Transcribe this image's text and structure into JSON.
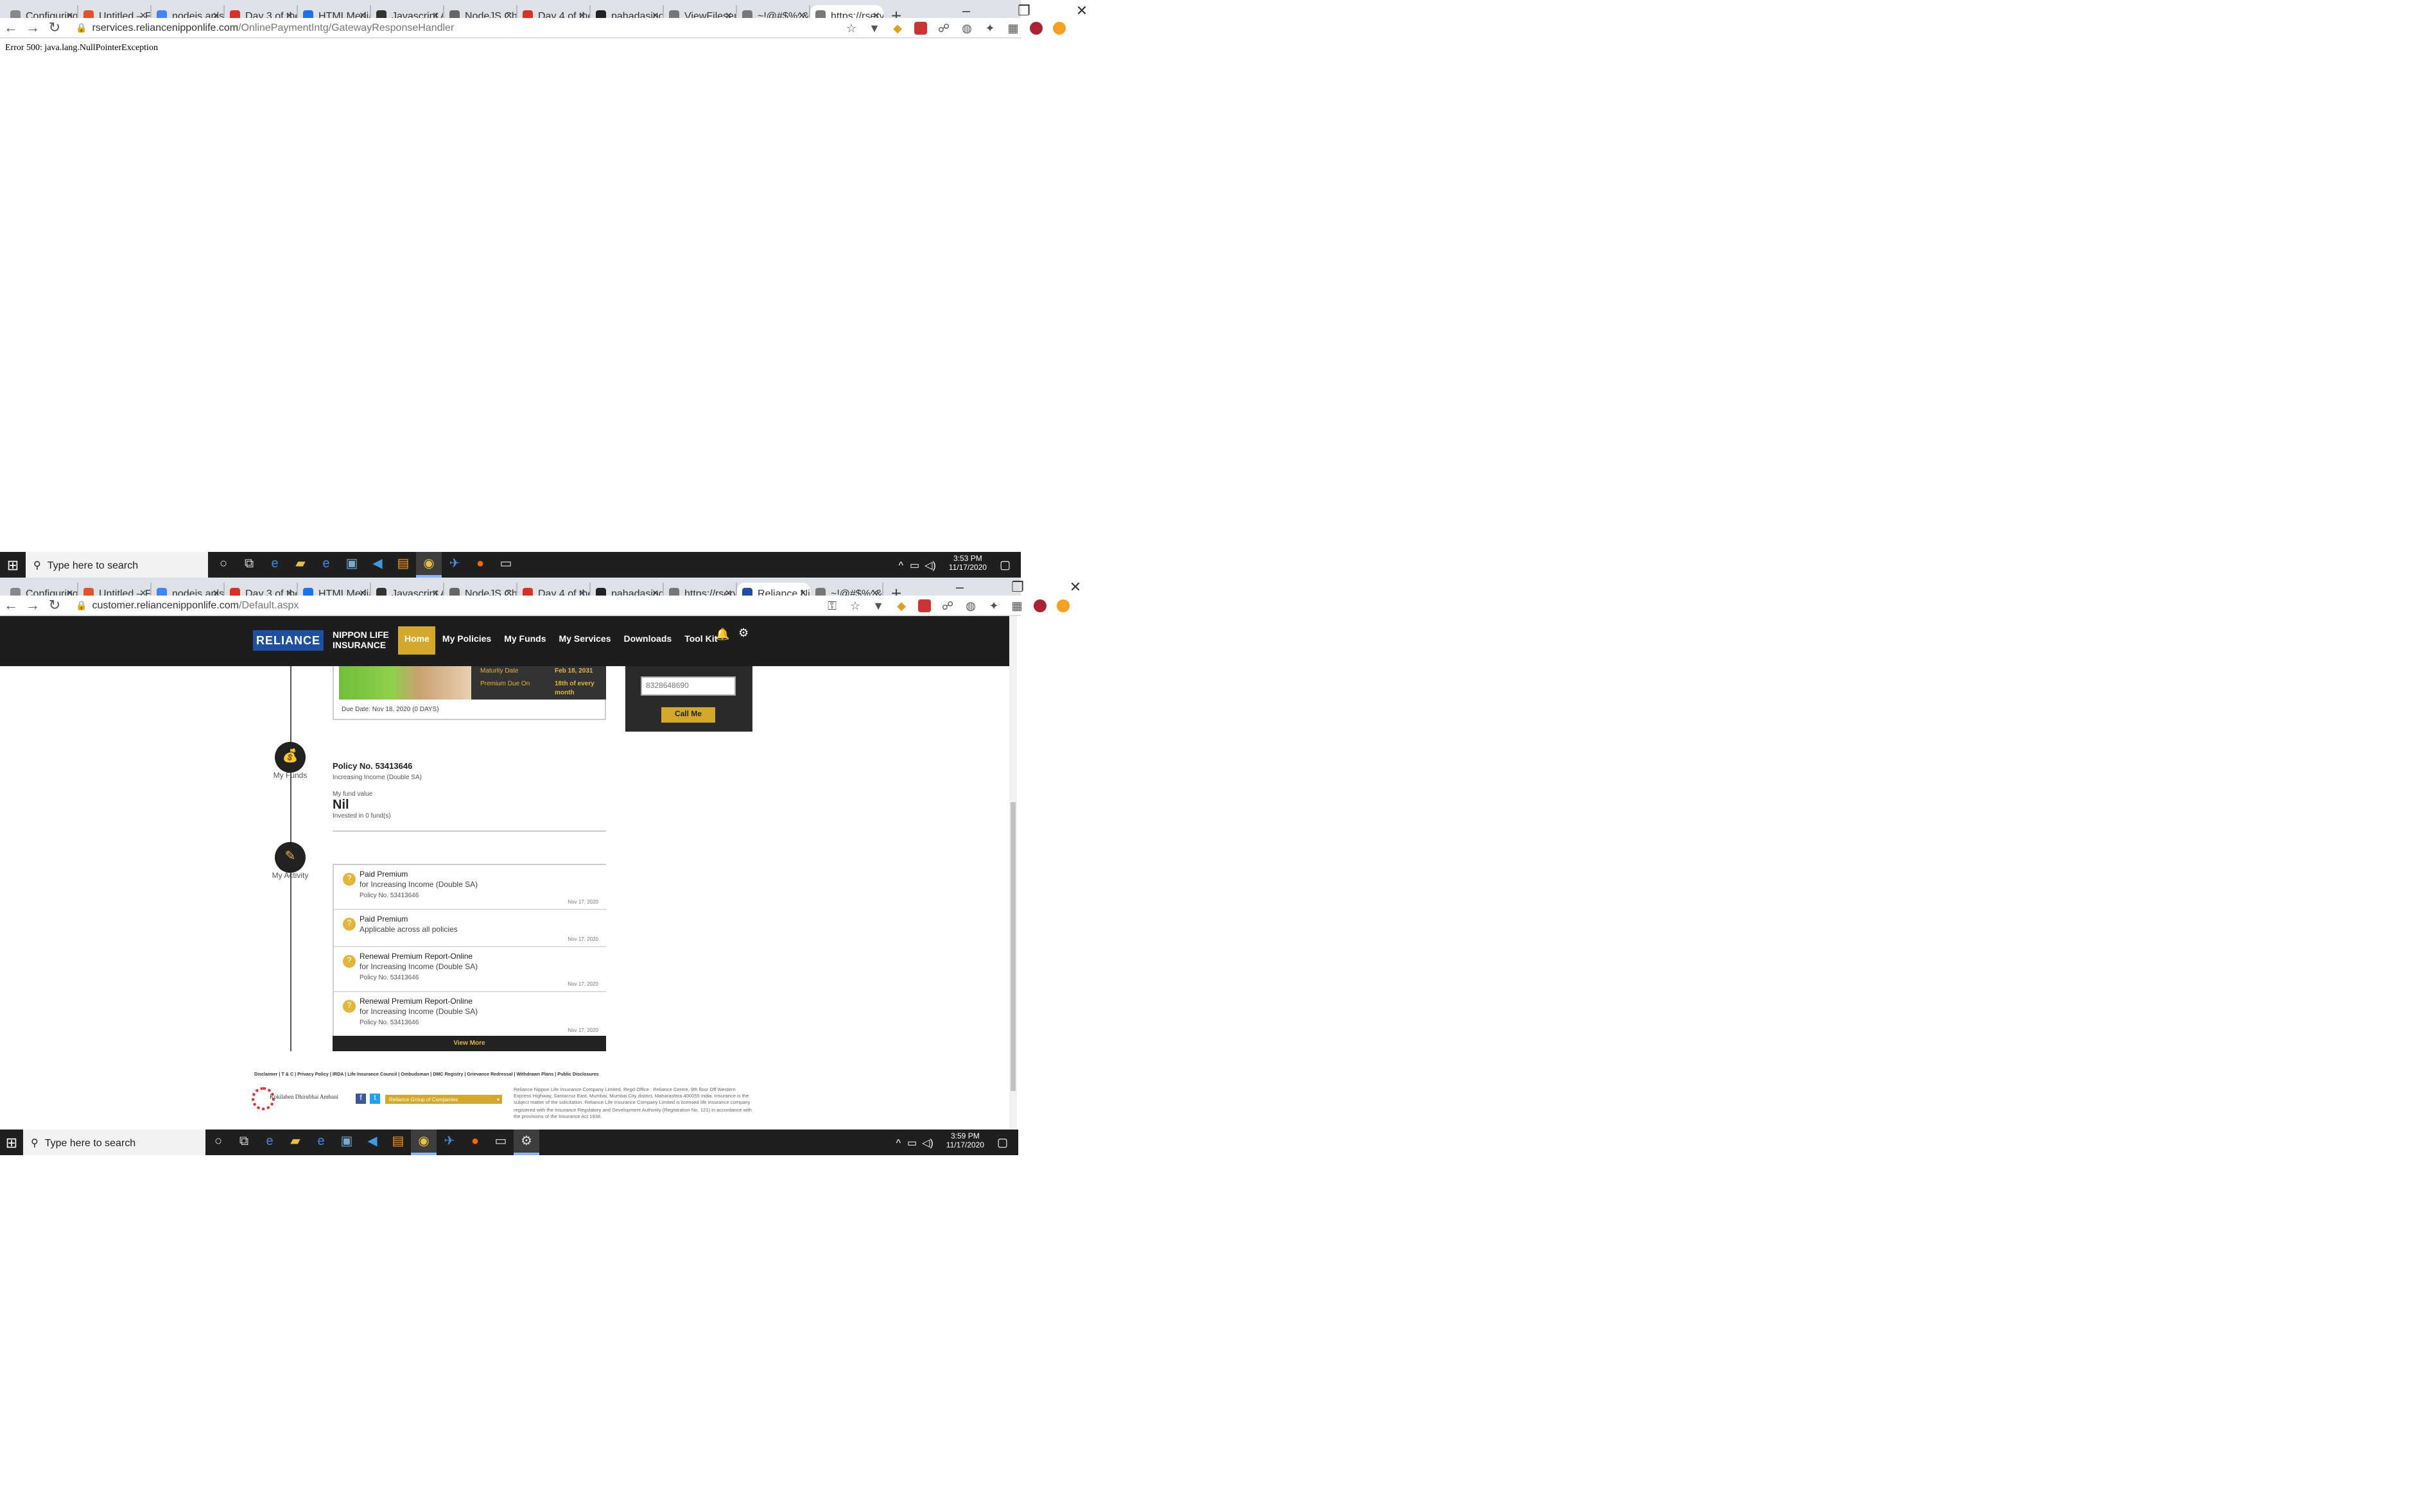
{
  "screen1": {
    "tabs": [
      {
        "label": "Configuring t",
        "color": "#888"
      },
      {
        "label": "Untitled – Figr",
        "color": "#e0542a"
      },
      {
        "label": "nodejs apis w",
        "color": "#4285f4"
      },
      {
        "label": "Day 3 of the",
        "color": "#d93025"
      },
      {
        "label": "HTMLMediaE",
        "color": "#1a73e8"
      },
      {
        "label": "Javascript Arr",
        "color": "#333"
      },
      {
        "label": "NodeJS Chea",
        "color": "#666"
      },
      {
        "label": "Day 4 of the",
        "color": "#d93025"
      },
      {
        "label": "pahadasingh",
        "color": "#222"
      },
      {
        "label": "ViewFileservle",
        "color": "#777"
      },
      {
        "label": "~!@#$%^&",
        "color": "#777"
      },
      {
        "label": "https://rserv",
        "color": "#777"
      }
    ],
    "url_host": "rservices.reliancenipponlife.com",
    "url_path": "/OnlinePaymentIntg/GatewayResponseHandler",
    "error_text": "Error 500: java.lang.NullPointerException",
    "taskbar": {
      "search_placeholder": "Type here to search",
      "time": "3:53 PM",
      "date": "11/17/2020"
    }
  },
  "screen2": {
    "tabs": [
      {
        "label": "Configuring t",
        "color": "#888"
      },
      {
        "label": "Untitled – Fig",
        "color": "#e0542a"
      },
      {
        "label": "nodejs apis w",
        "color": "#4285f4"
      },
      {
        "label": "Day 3 of the",
        "color": "#d93025"
      },
      {
        "label": "HTMLMediaE",
        "color": "#1a73e8"
      },
      {
        "label": "Javascript Arr",
        "color": "#333"
      },
      {
        "label": "NodeJS Chea",
        "color": "#666"
      },
      {
        "label": "Day 4 of the",
        "color": "#d93025"
      },
      {
        "label": "pahadasingh",
        "color": "#222"
      },
      {
        "label": "https://rservi",
        "color": "#777"
      },
      {
        "label": "Reliance Nipp",
        "color": "#1f4fa3"
      },
      {
        "label": "~!@#$%^&",
        "color": "#777"
      }
    ],
    "url_host": "customer.reliancenipponlife.com",
    "url_path": "/Default.aspx",
    "taskbar": {
      "search_placeholder": "Type here to search",
      "time": "3:59 PM",
      "date": "11/17/2020"
    }
  },
  "site": {
    "logo": "RELIANCE",
    "logo_sub1": "NIPPON LIFE",
    "logo_sub2": "INSURANCE",
    "menu": [
      "Home",
      "My Policies",
      "My Funds",
      "My Services",
      "Downloads",
      "Tool Kit"
    ],
    "policy_card": {
      "maturity_label": "Maturity Date",
      "maturity_value": "Feb 18, 2031",
      "premium_label": "Premium Due On",
      "premium_value": "18th of every month",
      "due_date": "Due Date: Nov 18, 2020 (0 DAYS)"
    },
    "callback": {
      "phone": "8328648690",
      "button": "Call Me"
    },
    "funds": {
      "section_label": "My Funds",
      "policy_no": "Policy No. 53413646",
      "plan": "Increasing Income (Double SA)",
      "fund_label": "My fund value",
      "fund_value": "Nil",
      "invested": "Invested in 0 fund(s)"
    },
    "activity": {
      "section_label": "My Activity",
      "items": [
        {
          "title": "Paid Premium",
          "line2": "for Increasing Income (Double SA)",
          "line3": "Policy No. 53413646",
          "date": "Nov 17, 2020"
        },
        {
          "title": "Paid Premium",
          "line2": "Applicable across all policies",
          "line3": "",
          "date": "Nov 17, 2020"
        },
        {
          "title": "Renewal Premium Report-Online",
          "line2": "for Increasing Income (Double SA)",
          "line3": "Policy No. 53413646",
          "date": "Nov 17, 2020"
        },
        {
          "title": "Renewal Premium Report-Online",
          "line2": "for Increasing Income (Double SA)",
          "line3": "Policy No. 53413646",
          "date": "Nov 17, 2020"
        }
      ],
      "view_more": "View More"
    },
    "footer": {
      "links": "Disclaimer | T & C | Privacy Policy | IRDA | Life Insurance Council | Ombudsman | DMC Registry | Grievance Redressal | Withdrawn Plans | Public Disclosures",
      "group_select": "Reliance Group of Companies",
      "kokilaben": "Kokilaben Dhirubhai Ambani",
      "legal": "Reliance Nippon Life Insurance Company Limited, Regd Office : Reliance Centre, 9th floor Off Western Express Highway, Santacruz East, Mumbai, Mumbai City district, Maharashtra 400055 India. Insurance is the subject matter of the solicitation. Reliance Life Insurance Company Limited is licensed life insurance company registered with the Insurance Regulatory and Development Authority (Registration No. 121) in accordance with the provisions of the Insurance Act 1938."
    }
  }
}
